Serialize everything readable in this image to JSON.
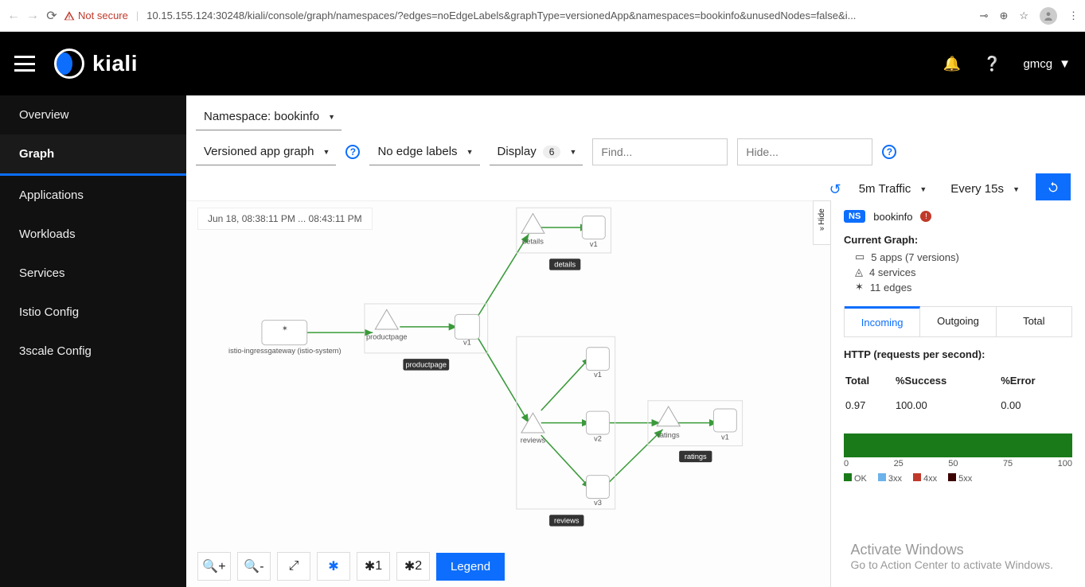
{
  "chrome": {
    "not_secure": "Not secure",
    "url": "10.15.155.124:30248/kiali/console/graph/namespaces/?edges=noEdgeLabels&graphType=versionedApp&namespaces=bookinfo&unusedNodes=false&i..."
  },
  "topbar": {
    "logo_text": "kiali",
    "username": "gmcg"
  },
  "sidebar": {
    "items": [
      {
        "label": "Overview"
      },
      {
        "label": "Graph"
      },
      {
        "label": "Applications"
      },
      {
        "label": "Workloads"
      },
      {
        "label": "Services"
      },
      {
        "label": "Istio Config"
      },
      {
        "label": "3scale Config"
      }
    ],
    "active_index": 1
  },
  "toolbar": {
    "namespace_label": "Namespace: bookinfo",
    "graph_type": "Versioned app graph",
    "edge_labels": "No edge labels",
    "display_label": "Display",
    "display_count": "6",
    "find_placeholder": "Find...",
    "hide_placeholder": "Hide...",
    "traffic": "5m Traffic",
    "refresh": "Every 15s"
  },
  "canvas": {
    "timestamp": "Jun 18, 08:38:11 PM ... 08:43:11 PM",
    "legend_button": "Legend",
    "layout_count_1": "1",
    "layout_count_2": "2",
    "hide_tab": "Hide",
    "nodes": {
      "ingress": "istio-ingressgateway (istio-system)",
      "productpage": "productpage",
      "productpage_v1": "v1",
      "productpage_tag": "productpage",
      "details": "details",
      "details_v1": "v1",
      "details_tag": "details",
      "reviews": "reviews",
      "reviews_v1": "v1",
      "reviews_v2": "v2",
      "reviews_v3": "v3",
      "reviews_tag": "reviews",
      "ratings": "ratings",
      "ratings_v1": "v1",
      "ratings_tag": "ratings"
    }
  },
  "info": {
    "ns_badge": "NS",
    "ns_name": "bookinfo",
    "current_graph_title": "Current Graph:",
    "stats": {
      "apps": "5 apps (7 versions)",
      "services": "4 services",
      "edges": "11 edges"
    },
    "tabs": {
      "incoming": "Incoming",
      "outgoing": "Outgoing",
      "total": "Total"
    },
    "http_title": "HTTP (requests per second):",
    "columns": {
      "total": "Total",
      "success": "%Success",
      "error": "%Error"
    },
    "values": {
      "total": "0.97",
      "success": "100.00",
      "error": "0.00"
    },
    "axis": [
      "0",
      "25",
      "50",
      "75",
      "100"
    ],
    "legend": {
      "ok": "OK",
      "c3xx": "3xx",
      "c4xx": "4xx",
      "c5xx": "5xx"
    }
  },
  "watermark": {
    "line1": "Activate Windows",
    "line2": "Go to Action Center to activate Windows."
  }
}
